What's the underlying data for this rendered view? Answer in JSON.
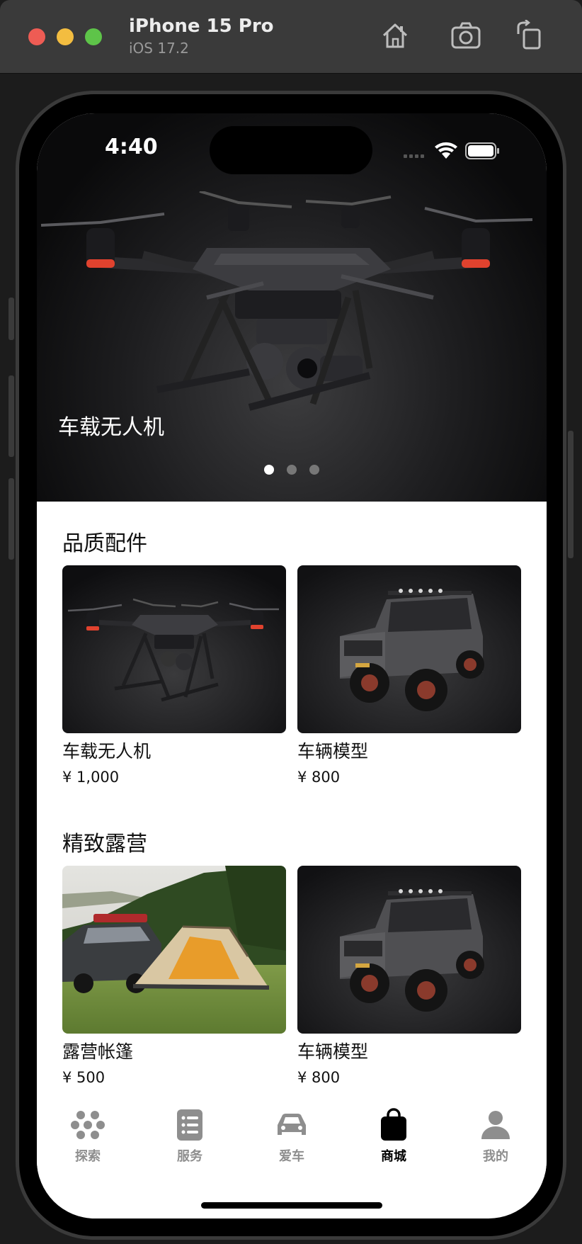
{
  "window": {
    "device_name": "iPhone 15 Pro",
    "os_version": "iOS 17.2"
  },
  "status_bar": {
    "time": "4:40"
  },
  "hero": {
    "caption": "车载无人机",
    "page_count": 3,
    "active_page": 1
  },
  "sections": [
    {
      "title": "品质配件",
      "products": [
        {
          "name": "车载无人机",
          "price": "¥ 1,000",
          "image": "drone"
        },
        {
          "name": "车辆模型",
          "price": "¥ 800",
          "image": "suv-model"
        }
      ]
    },
    {
      "title": "精致露营",
      "products": [
        {
          "name": "露营帐篷",
          "price": "¥ 500",
          "image": "camping-tent"
        },
        {
          "name": "车辆模型",
          "price": "¥ 800",
          "image": "suv-model"
        }
      ]
    }
  ],
  "tabbar": {
    "items": [
      {
        "label": "探索",
        "icon": "explore-icon",
        "active": false
      },
      {
        "label": "服务",
        "icon": "list-icon",
        "active": false
      },
      {
        "label": "爱车",
        "icon": "car-icon",
        "active": false
      },
      {
        "label": "商城",
        "icon": "shopping-bag-icon",
        "active": true
      },
      {
        "label": "我的",
        "icon": "person-icon",
        "active": false
      }
    ]
  },
  "colors": {
    "active_tab": "#000000",
    "inactive_tab": "#8e8e8e",
    "traffic_red": "#ee5c54",
    "traffic_yellow": "#f3bd40",
    "traffic_green": "#5ec449"
  }
}
